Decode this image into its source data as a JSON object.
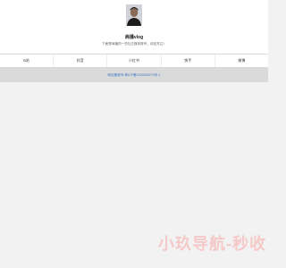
{
  "profile": {
    "name": "商播vlog",
    "tagline": "下面是商播的一些社交媒体账号，欢迎关注！"
  },
  "nav": {
    "items": [
      {
        "label": "B站"
      },
      {
        "label": "抖音"
      },
      {
        "label": "小红书"
      },
      {
        "label": "快手"
      },
      {
        "label": "微博"
      }
    ]
  },
  "footer": {
    "icp_text": "网站备案号:粤ICP备2024090274号-1"
  },
  "watermark": {
    "text": "小玖导航-秒收"
  },
  "colors": {
    "background": "#f2f2f2",
    "card": "#ffffff",
    "infobar": "#dadada",
    "link": "#3a78c3",
    "watermark": "#f6c9c9"
  }
}
